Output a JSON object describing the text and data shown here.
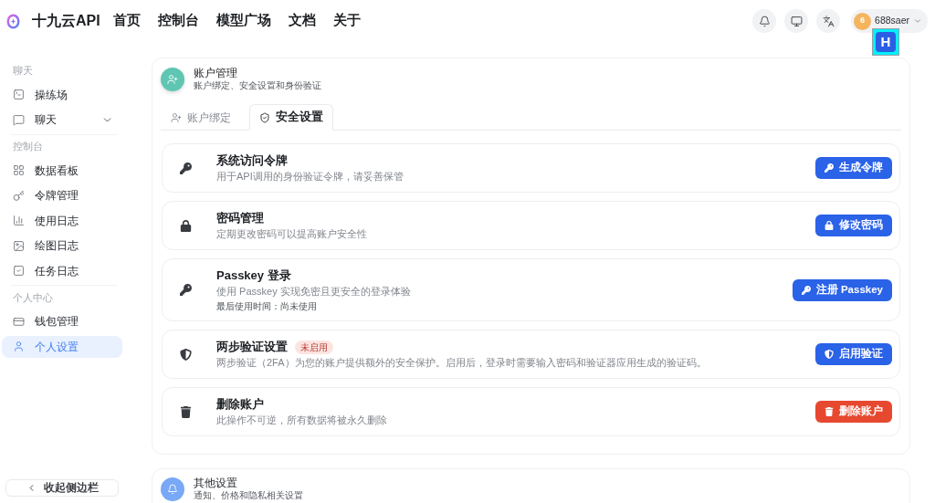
{
  "header": {
    "brand": "十九云API",
    "nav": [
      {
        "label": "首页"
      },
      {
        "label": "控制台"
      },
      {
        "label": "模型广场"
      },
      {
        "label": "文档"
      },
      {
        "label": "关于"
      }
    ],
    "user": {
      "avatar": "6",
      "name": "688saer"
    },
    "overlay_badge": {
      "label": "H"
    }
  },
  "sidebar": {
    "sections": [
      {
        "title": "聊天",
        "items": [
          {
            "label": "操练场",
            "kind": "link",
            "selected": false
          },
          {
            "label": "聊天",
            "kind": "group",
            "expanded": false,
            "selected": false
          }
        ]
      },
      {
        "title": "控制台",
        "items": [
          {
            "label": "数据看板",
            "kind": "link",
            "selected": false
          },
          {
            "label": "令牌管理",
            "kind": "link",
            "selected": false
          },
          {
            "label": "使用日志",
            "kind": "link",
            "selected": false
          },
          {
            "label": "绘图日志",
            "kind": "link",
            "selected": false
          },
          {
            "label": "任务日志",
            "kind": "link",
            "selected": false
          }
        ]
      },
      {
        "title": "个人中心",
        "items": [
          {
            "label": "钱包管理",
            "kind": "link",
            "selected": false
          },
          {
            "label": "个人设置",
            "kind": "link",
            "selected": true
          }
        ]
      }
    ],
    "collapse_button": {
      "label": "收起侧边栏"
    }
  },
  "account_card": {
    "title": "账户管理",
    "subtitle": "账户绑定、安全设置和身份验证",
    "tabs": [
      {
        "label": "账户绑定",
        "selected": false
      },
      {
        "label": "安全设置",
        "selected": true
      }
    ],
    "rows": [
      {
        "title": "系统访问令牌",
        "description": "用于API调用的身份验证令牌，请妥善保管",
        "button": {
          "label": "生成令牌",
          "kind": "primary"
        }
      },
      {
        "title": "密码管理",
        "description": "定期更改密码可以提高账户安全性",
        "button": {
          "label": "修改密码",
          "kind": "primary"
        }
      },
      {
        "title": "Passkey 登录",
        "description": "使用 Passkey 实现免密且更安全的登录体验",
        "note": "最后使用时间：尚未使用",
        "button": {
          "label": "注册 Passkey",
          "kind": "primary"
        }
      },
      {
        "title": "两步验证设置",
        "badge": "未启用",
        "description": "两步验证（2FA）为您的账户提供额外的安全保护。启用后，登录时需要输入密码和验证器应用生成的验证码。",
        "button": {
          "label": "启用验证",
          "kind": "primary"
        }
      },
      {
        "title": "删除账户",
        "description": "此操作不可逆，所有数据将被永久删除",
        "button": {
          "label": "删除账户",
          "kind": "danger"
        }
      }
    ]
  },
  "other_card": {
    "title": "其他设置",
    "subtitle": "通知、价格和隐私相关设置"
  }
}
